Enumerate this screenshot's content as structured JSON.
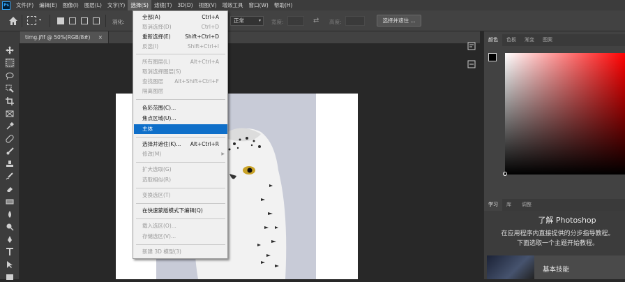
{
  "menubar": {
    "logo": "Ps",
    "items": [
      "文件(F)",
      "编辑(E)",
      "图像(I)",
      "图层(L)",
      "文字(Y)",
      "选择(S)",
      "滤镜(T)",
      "3D(D)",
      "视图(V)",
      "增效工具",
      "窗口(W)",
      "帮助(H)"
    ],
    "active_index": 5
  },
  "options": {
    "feather_label": "羽化:",
    "style_value": "正常",
    "width_label": "宽度:",
    "height_label": "高度:",
    "select_mask_button": "选择并遮住 ..."
  },
  "document": {
    "tab_title": "timg.jfif @ 50%(RGB/8#)",
    "close": "×"
  },
  "select_menu": {
    "items": [
      {
        "label": "全部(A)",
        "shortcut": "Ctrl+A",
        "enabled": true
      },
      {
        "label": "取消选择(D)",
        "shortcut": "Ctrl+D",
        "enabled": false
      },
      {
        "label": "重新选择(E)",
        "shortcut": "Shift+Ctrl+D",
        "enabled": true
      },
      {
        "label": "反选(I)",
        "shortcut": "Shift+Ctrl+I",
        "enabled": false
      },
      {
        "label": "所有图层(L)",
        "shortcut": "Alt+Ctrl+A",
        "enabled": false
      },
      {
        "label": "取消选择图层(S)",
        "shortcut": "",
        "enabled": false
      },
      {
        "label": "查找图层",
        "shortcut": "Alt+Shift+Ctrl+F",
        "enabled": false
      },
      {
        "label": "隔离图层",
        "shortcut": "",
        "enabled": false
      },
      {
        "label": "色彩范围(C)...",
        "shortcut": "",
        "enabled": true
      },
      {
        "label": "焦点区域(U)...",
        "shortcut": "",
        "enabled": true
      },
      {
        "label": "主体",
        "shortcut": "",
        "enabled": true,
        "highlighted": true
      },
      {
        "label": "选择并遮住(K)...",
        "shortcut": "Alt+Ctrl+R",
        "enabled": true
      },
      {
        "label": "修改(M)",
        "shortcut": "",
        "enabled": false,
        "submenu": true
      },
      {
        "label": "扩大选取(G)",
        "shortcut": "",
        "enabled": false
      },
      {
        "label": "选取相似(R)",
        "shortcut": "",
        "enabled": false
      },
      {
        "label": "变换选区(T)",
        "shortcut": "",
        "enabled": false
      },
      {
        "label": "在快速蒙版模式下编辑(Q)",
        "shortcut": "",
        "enabled": true
      },
      {
        "label": "载入选区(O)...",
        "shortcut": "",
        "enabled": false
      },
      {
        "label": "存储选区(V)...",
        "shortcut": "",
        "enabled": false
      },
      {
        "label": "新建 3D 模型(3)",
        "shortcut": "",
        "enabled": false
      }
    ]
  },
  "color_panel": {
    "tabs": [
      "颜色",
      "色板",
      "渐变",
      "图案"
    ],
    "foreground": "#000000",
    "background": "#ffffff",
    "hue": "#ff0000"
  },
  "learn_panel": {
    "tabs": [
      "学习",
      "库",
      "调整"
    ],
    "title": "了解 Photoshop",
    "desc_line1": "在应用程序内直接提供的分步指导教程。",
    "desc_line2": "下面选取一个主题开始教程。",
    "card_label": "基本技能"
  }
}
